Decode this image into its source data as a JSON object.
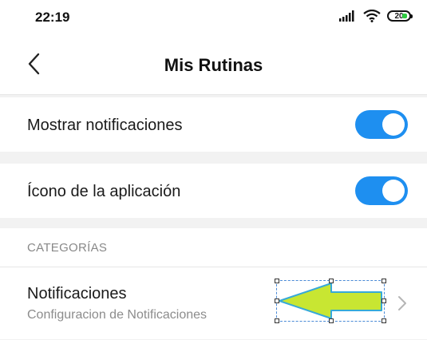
{
  "status_bar": {
    "time": "22:19",
    "battery": "20",
    "icons": [
      "signal-icon",
      "wifi-icon",
      "battery-icon"
    ]
  },
  "header": {
    "title": "Mis Rutinas",
    "back_icon": "chevron-left-icon"
  },
  "settings": [
    {
      "label": "Mostrar notificaciones",
      "enabled": true
    },
    {
      "label": "Ícono de la aplicación",
      "enabled": true
    }
  ],
  "section": {
    "header": "CATEGORÍAS"
  },
  "categories": [
    {
      "title": "Notificaciones",
      "subtitle": "Configuracion de Notificaciones",
      "icon": "chevron-right-icon"
    }
  ],
  "annotation": {
    "icon": "arrow-left-icon",
    "color": "#c8e632",
    "outline": "#36a9d9"
  },
  "colors": {
    "accent": "#1e8ff0",
    "background": "#f2f2f2"
  }
}
